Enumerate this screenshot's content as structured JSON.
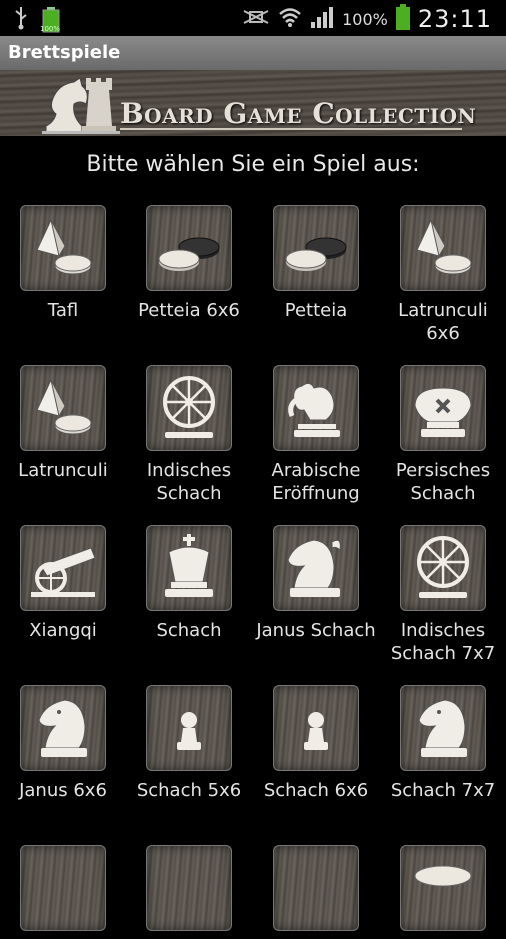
{
  "status_bar": {
    "battery_pct": "100%",
    "small_battery_label": "100%",
    "time": "23:11"
  },
  "title_bar": {
    "title": "Brettspiele"
  },
  "banner": {
    "title": "Board Game Collection"
  },
  "prompt": "Bitte wählen Sie ein Spiel aus:",
  "games": [
    {
      "label": "Tafl",
      "icon": "pyramid-disk-icon"
    },
    {
      "label": "Petteia 6x6",
      "icon": "two-disks-icon"
    },
    {
      "label": "Petteia",
      "icon": "two-disks-icon"
    },
    {
      "label": "Latrunculi 6x6",
      "icon": "pyramid-disk-icon"
    },
    {
      "label": "Latrunculi",
      "icon": "pyramid-disk-icon"
    },
    {
      "label": "Indisches Schach",
      "icon": "chariot-wheel-icon"
    },
    {
      "label": "Arabische Eröffnung",
      "icon": "elephant-icon"
    },
    {
      "label": "Persisches Schach",
      "icon": "persian-king-icon"
    },
    {
      "label": "Xiangqi",
      "icon": "cannon-icon"
    },
    {
      "label": "Schach",
      "icon": "king-icon"
    },
    {
      "label": "Janus Schach",
      "icon": "janus-knight-icon"
    },
    {
      "label": "Indisches Schach 7x7",
      "icon": "chariot-wheel-icon"
    },
    {
      "label": "Janus 6x6",
      "icon": "knight-icon"
    },
    {
      "label": "Schach 5x6",
      "icon": "pawn-icon"
    },
    {
      "label": "Schach 6x6",
      "icon": "pawn-icon"
    },
    {
      "label": "Schach 7x7",
      "icon": "knight-icon"
    },
    {
      "label": "",
      "icon": "partial-tile"
    },
    {
      "label": "",
      "icon": "partial-tile"
    },
    {
      "label": "",
      "icon": "partial-tile"
    },
    {
      "label": "",
      "icon": "partial-tile-disk"
    }
  ]
}
